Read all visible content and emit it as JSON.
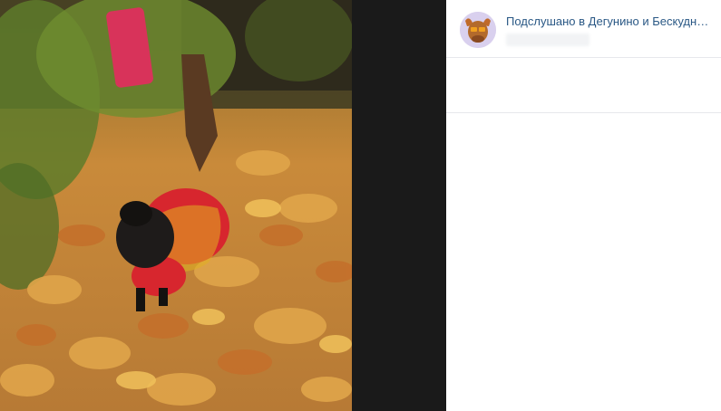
{
  "post": {
    "author_name": "Подслушано в Дегунино и Бескудниково",
    "date": "",
    "text": ""
  },
  "photo": {
    "subject": "dog-in-autumn-leaves"
  },
  "colors": {
    "link": "#2a5885",
    "divider": "#e7e8ec",
    "viewer_bg": "#1a1a1a"
  }
}
